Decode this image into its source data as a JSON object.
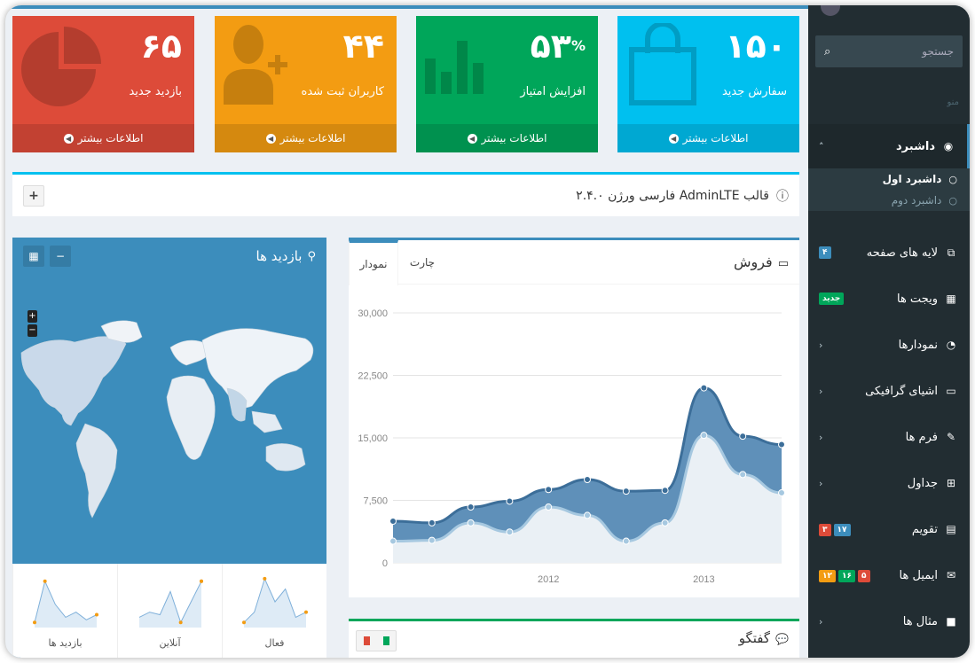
{
  "colors": {
    "aqua": "#00c0ef",
    "green": "#00a65a",
    "orange": "#f39c12",
    "red": "#dd4b39",
    "blue": "#3c8dbc",
    "sidebar": "#222d32"
  },
  "sidebar": {
    "search_placeholder": "جستجو",
    "menu_header": "منو",
    "items": [
      {
        "label": "داشبرد",
        "icon": "dashboard-icon"
      },
      {
        "label": "لایه های صفحه",
        "icon": "files-icon",
        "badge": "۴"
      },
      {
        "label": "ویجت ها",
        "icon": "grid-icon",
        "badge": "جدید"
      },
      {
        "label": "نمودارها",
        "icon": "pie-chart-icon"
      },
      {
        "label": "اشیای گرافیکی",
        "icon": "laptop-icon"
      },
      {
        "label": "فرم ها",
        "icon": "edit-icon"
      },
      {
        "label": "جداول",
        "icon": "table-icon"
      },
      {
        "label": "تقویم",
        "icon": "calendar-icon",
        "badges": [
          "۱۷",
          "۳"
        ]
      },
      {
        "label": "ایمیل ها",
        "icon": "envelope-icon",
        "badges": [
          "۵",
          "۱۶",
          "۱۲"
        ]
      },
      {
        "label": "مثال ها",
        "icon": "folder-icon"
      }
    ],
    "subitems": [
      "داشبرد اول",
      "داشبرد دوم"
    ]
  },
  "boxes": [
    {
      "value": "۱۵۰",
      "caption": "سفارش جدید",
      "footer": "اطلاعات بیشتر",
      "color": "#00c0ef",
      "icon": "shopping-bag-icon"
    },
    {
      "value": "۵۳",
      "suffix": "%",
      "caption": "افزایش امتیاز",
      "footer": "اطلاعات بیشتر",
      "color": "#00a65a",
      "icon": "bar-chart-icon"
    },
    {
      "value": "۴۴",
      "caption": "کاربران ثبت شده",
      "footer": "اطلاعات بیشتر",
      "color": "#f39c12",
      "icon": "user-add-icon"
    },
    {
      "value": "۶۵",
      "caption": "بازدید جدید",
      "footer": "اطلاعات بیشتر",
      "color": "#dd4b39",
      "icon": "pie-chart-icon"
    }
  ],
  "info": {
    "title": "قالب AdminLTE فارسی ورژن ۲.۴.۰"
  },
  "map": {
    "title": "بازدید ها",
    "sparklines": [
      {
        "label": "بازدید ها",
        "values": [
          0.1,
          0.9,
          0.45,
          0.2,
          0.3,
          0.15,
          0.25
        ]
      },
      {
        "label": "آنلاین",
        "values": [
          0.2,
          0.3,
          0.25,
          0.7,
          0.1,
          0.5,
          0.9
        ]
      },
      {
        "label": "فعال",
        "values": [
          0.1,
          0.3,
          0.95,
          0.5,
          0.75,
          0.2,
          0.3
        ]
      }
    ]
  },
  "sales": {
    "title": "فروش",
    "tabs": [
      "چارت",
      "نمودار"
    ]
  },
  "chat": {
    "title": "گفتگو"
  },
  "chart_data": {
    "type": "area",
    "ylim": [
      0,
      30000
    ],
    "yticks": [
      "30,000",
      "22,500",
      "15,000",
      "7,500",
      "0"
    ],
    "yvals": [
      30000,
      22500,
      15000,
      7500,
      0
    ],
    "xticks": [
      {
        "label": "2012",
        "x": 2012
      },
      {
        "label": "2013",
        "x": 2013
      }
    ],
    "x": [
      2011.0,
      2011.25,
      2011.5,
      2011.75,
      2012.0,
      2012.25,
      2012.5,
      2012.75,
      2013.0,
      2013.25,
      2013.5
    ],
    "xlim": [
      2011.0,
      2013.5
    ],
    "series": [
      {
        "values": [
          5000,
          4800,
          6700,
          7400,
          8800,
          10000,
          8600,
          8700,
          21000,
          15200,
          14200
        ]
      },
      {
        "values": [
          2600,
          2700,
          4800,
          3700,
          6700,
          5700,
          2600,
          4800,
          15300,
          10600,
          8400
        ]
      }
    ]
  }
}
